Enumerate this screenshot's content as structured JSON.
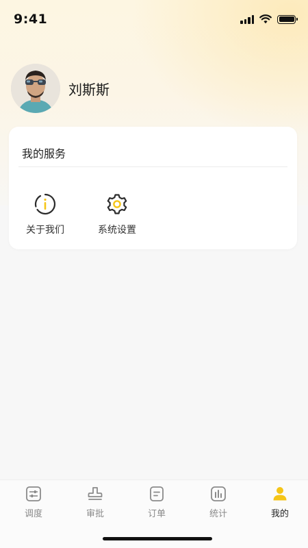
{
  "status_bar": {
    "time": "9:41"
  },
  "profile": {
    "name": "刘斯斯"
  },
  "services": {
    "title": "我的服务",
    "items": [
      {
        "label": "关于我们",
        "icon": "info-icon"
      },
      {
        "label": "系统设置",
        "icon": "gear-icon"
      }
    ]
  },
  "tab_bar": {
    "active": "我的",
    "tabs": [
      {
        "label": "调度",
        "icon": "dispatch-icon"
      },
      {
        "label": "审批",
        "icon": "approval-stamp-icon"
      },
      {
        "label": "订单",
        "icon": "order-icon"
      },
      {
        "label": "统计",
        "icon": "statistics-icon"
      },
      {
        "label": "我的",
        "icon": "user-icon"
      }
    ]
  },
  "colors": {
    "accent": "#F5C518",
    "icon_gray": "#8a8a8a",
    "text": "#222222"
  }
}
